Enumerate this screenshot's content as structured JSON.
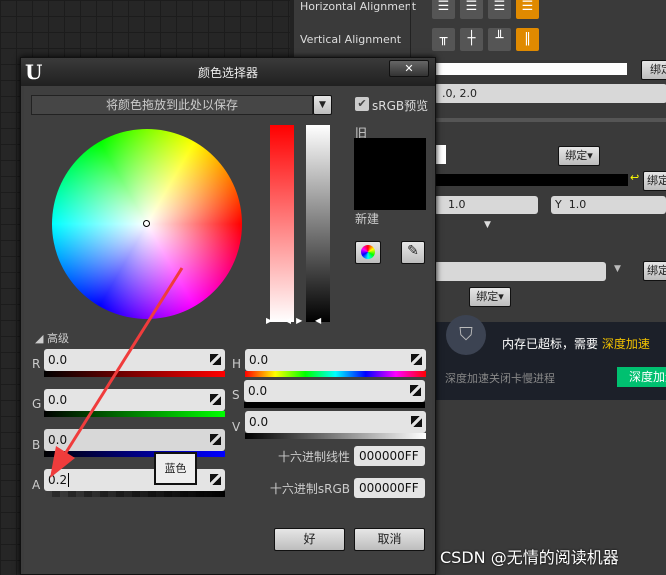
{
  "panel": {
    "horizontal_alignment": "Horizontal Alignment",
    "vertical_alignment": "Vertical Alignment",
    "bind": "绑定",
    "bind_dd": "绑定▾",
    "value_field": ".0, 2.0",
    "x_value": "1.0",
    "y_label": "Y",
    "y_value": "1.0"
  },
  "dialog": {
    "title": "颜色选择器",
    "close": "✕",
    "swatch_drop": "将颜色拖放到此处以保存",
    "srgb_preview": "sRGB预览",
    "old": "旧",
    "new": "新建",
    "advanced": "高级",
    "r_label": "R",
    "r": "0.0",
    "g_label": "G",
    "g": "0.0",
    "b_label": "B",
    "b": "0.0",
    "a_label": "A",
    "a": "0.2",
    "h_label": "H",
    "h": "0.0",
    "s_label": "S",
    "s": "0.0",
    "v_label": "V",
    "v": "0.0",
    "hex_linear_label": "十六进制线性",
    "hex_linear": "000000FF",
    "hex_srgb_label": "十六进制sRGB",
    "hex_srgb": "000000FF",
    "tooltip": "蓝色",
    "ok": "好",
    "cancel": "取消"
  },
  "notification": {
    "message": "内存已超标，需要",
    "highlight": "深度加速",
    "sub": "深度加速关闭卡慢进程",
    "action": "深度加速"
  },
  "watermark": "CSDN @无情的阅读机器"
}
